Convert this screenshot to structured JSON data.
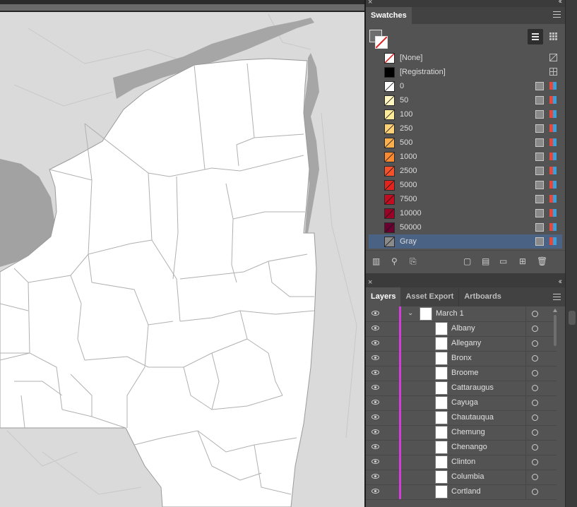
{
  "swatches_panel": {
    "tab": "Swatches",
    "items": [
      {
        "name": "[None]",
        "color": "none"
      },
      {
        "name": "[Registration]",
        "color": "#000000"
      },
      {
        "name": "0",
        "color": "#ffffff"
      },
      {
        "name": "50",
        "color": "#fff6c0"
      },
      {
        "name": "100",
        "color": "#ffec9a"
      },
      {
        "name": "250",
        "color": "#fed178"
      },
      {
        "name": "500",
        "color": "#fdb04c"
      },
      {
        "name": "1000",
        "color": "#fc8a30"
      },
      {
        "name": "2500",
        "color": "#f6512a"
      },
      {
        "name": "5000",
        "color": "#e3241e"
      },
      {
        "name": "7500",
        "color": "#c40d20"
      },
      {
        "name": "10000",
        "color": "#9a0226"
      },
      {
        "name": "50000",
        "color": "#6a0130"
      },
      {
        "name": "Gray",
        "color": "#8a8a8a"
      }
    ],
    "selected": "Gray"
  },
  "layers_panel": {
    "tabs": [
      "Layers",
      "Asset Export",
      "Artboards"
    ],
    "active_tab": "Layers",
    "parent_layer": "March 1",
    "layer_color": "#d43ed8",
    "sublayers": [
      "Albany",
      "Allegany",
      "Bronx",
      "Broome",
      "Cattaraugus",
      "Cayuga",
      "Chautauqua",
      "Chemung",
      "Chenango",
      "Clinton",
      "Columbia",
      "Cortland"
    ]
  },
  "icons": {
    "swatch_bottom": [
      "swatch-libraries-icon",
      "swatch-kind-icon",
      "show-swatch-options-icon",
      "new-color-group-icon",
      "swatch-options-icon",
      "new-folder-icon",
      "new-swatch-icon",
      "delete-icon"
    ]
  }
}
